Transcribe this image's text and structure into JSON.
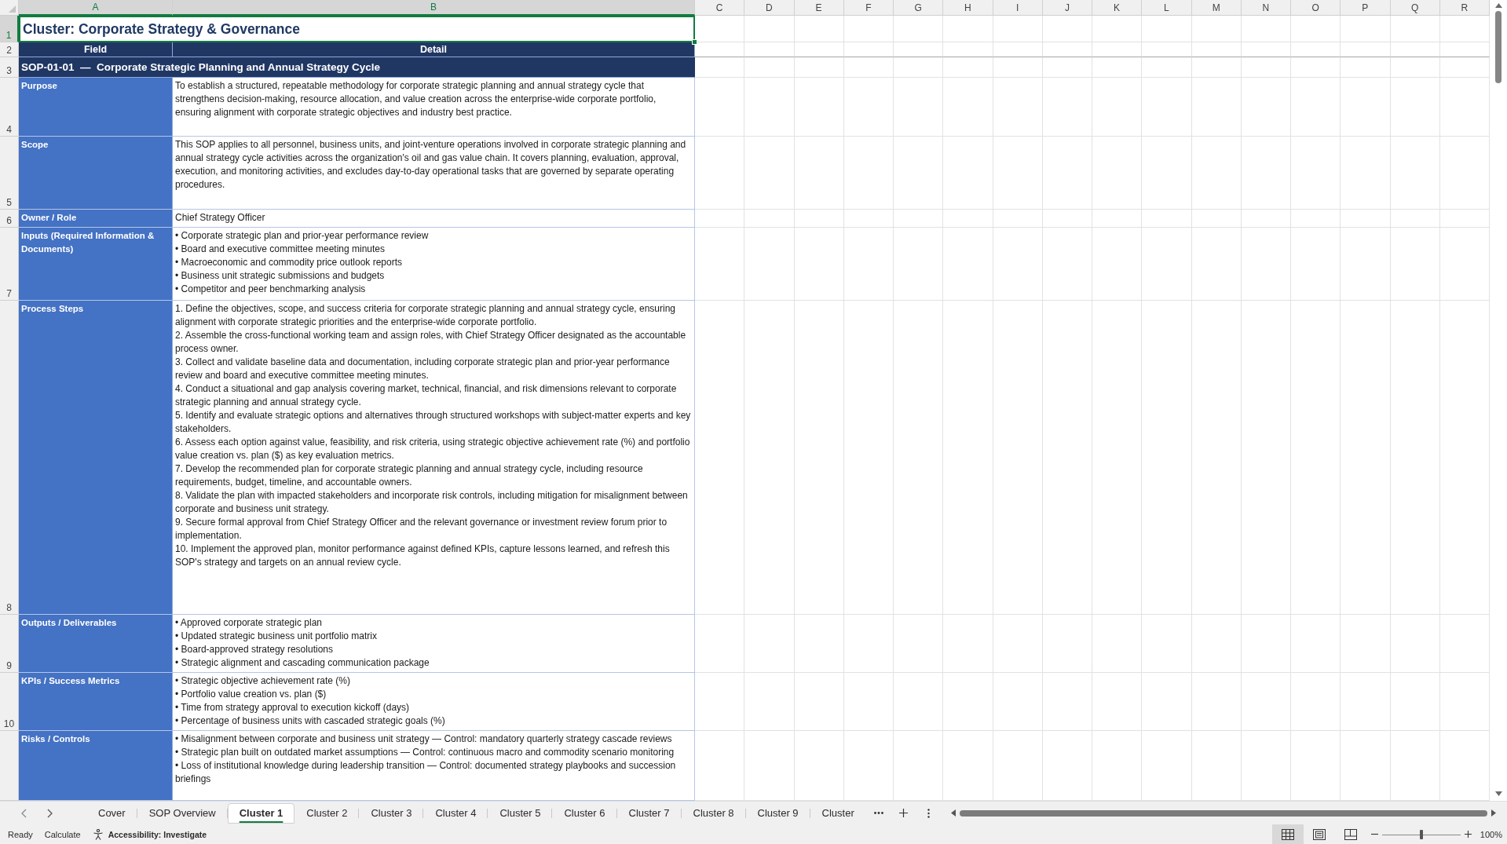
{
  "columns": [
    {
      "label": "A",
      "selected": true
    },
    {
      "label": "B",
      "selected": true
    },
    {
      "label": "C",
      "selected": false
    },
    {
      "label": "D",
      "selected": false
    },
    {
      "label": "E",
      "selected": false
    },
    {
      "label": "F",
      "selected": false
    },
    {
      "label": "G",
      "selected": false
    },
    {
      "label": "H",
      "selected": false
    },
    {
      "label": "I",
      "selected": false
    },
    {
      "label": "J",
      "selected": false
    },
    {
      "label": "K",
      "selected": false
    },
    {
      "label": "L",
      "selected": false
    },
    {
      "label": "M",
      "selected": false
    },
    {
      "label": "N",
      "selected": false
    },
    {
      "label": "O",
      "selected": false
    },
    {
      "label": "P",
      "selected": false
    },
    {
      "label": "Q",
      "selected": false
    },
    {
      "label": "R",
      "selected": false
    }
  ],
  "row_headers": [
    {
      "label": "1",
      "selected": true
    },
    {
      "label": "2",
      "selected": false
    },
    {
      "label": "3",
      "selected": false
    },
    {
      "label": "4",
      "selected": false
    },
    {
      "label": "5",
      "selected": false
    },
    {
      "label": "6",
      "selected": false
    },
    {
      "label": "7",
      "selected": false
    },
    {
      "label": "8",
      "selected": false
    },
    {
      "label": "9",
      "selected": false
    },
    {
      "label": "10",
      "selected": false
    }
  ],
  "title": {
    "text": "Cluster: Corporate Strategy & Governance",
    "selected": true
  },
  "table_header": [
    "Field",
    "Detail"
  ],
  "section_heading": "SOP-01-01  —  Corporate Strategic Planning and Annual Strategy Cycle",
  "fields": [
    {
      "label": "Purpose",
      "kind": "text",
      "text": "To establish a structured, repeatable methodology for corporate strategic planning and annual strategy cycle that strengthens decision-making, resource allocation, and value creation across the enterprise-wide corporate portfolio, ensuring alignment with corporate strategic objectives and industry best practice."
    },
    {
      "label": "Scope",
      "kind": "text",
      "text": "This SOP applies to all personnel, business units, and joint-venture operations involved in corporate strategic planning and annual strategy cycle activities across the organization's oil and gas value chain. It covers planning, evaluation, approval, execution, and monitoring activities, and excludes day-to-day operational tasks that are governed by separate operating procedures."
    },
    {
      "label": "Owner / Role",
      "kind": "text",
      "text": "Chief Strategy Officer"
    },
    {
      "label": "Inputs (Required Information & Documents)",
      "kind": "list",
      "items": [
        "• Corporate strategic plan and prior-year performance review",
        "• Board and executive committee meeting minutes",
        "• Macroeconomic and commodity price outlook reports",
        "• Business unit strategic submissions and budgets",
        "• Competitor and peer benchmarking analysis"
      ]
    },
    {
      "label": "Process Steps",
      "kind": "list",
      "items": [
        "1. Define the objectives, scope, and success criteria for corporate strategic planning and annual strategy cycle, ensuring alignment with corporate strategic priorities and the enterprise-wide corporate portfolio.",
        "2. Assemble the cross-functional working team and assign roles, with Chief Strategy Officer designated as the accountable process owner.",
        "3. Collect and validate baseline data and documentation, including corporate strategic plan and prior-year performance review and board and executive committee meeting minutes.",
        "4. Conduct a situational and gap analysis covering market, technical, financial, and risk dimensions relevant to corporate strategic planning and annual strategy cycle.",
        "5. Identify and evaluate strategic options and alternatives through structured workshops with subject-matter experts and key stakeholders.",
        "6. Assess each option against value, feasibility, and risk criteria, using strategic objective achievement rate (%) and portfolio value creation vs. plan ($) as key evaluation metrics.",
        "7. Develop the recommended plan for corporate strategic planning and annual strategy cycle, including resource requirements, budget, timeline, and accountable owners.",
        "8. Validate the plan with impacted stakeholders and incorporate risk controls, including mitigation for misalignment between corporate and business unit strategy.",
        "9. Secure formal approval from Chief Strategy Officer and the relevant governance or investment review forum prior to implementation.",
        "10. Implement the approved plan, monitor performance against defined KPIs, capture lessons learned, and refresh this SOP's strategy and targets on an annual review cycle."
      ]
    },
    {
      "label": "Outputs / Deliverables",
      "kind": "list",
      "items": [
        "• Approved corporate strategic plan",
        "• Updated strategic business unit portfolio matrix",
        "• Board-approved strategy resolutions",
        "• Strategic alignment and cascading communication package"
      ]
    },
    {
      "label": "KPIs / Success Metrics",
      "kind": "list",
      "items": [
        "• Strategic objective achievement rate (%)",
        "• Portfolio value creation vs. plan ($)",
        "• Time from strategy approval to execution kickoff (days)",
        "• Percentage of business units with cascaded strategic goals (%)"
      ]
    },
    {
      "label": "Risks / Controls",
      "kind": "list",
      "items": [
        "• Misalignment between corporate and business unit strategy — Control: mandatory quarterly strategy cascade reviews",
        "• Strategic plan built on outdated market assumptions — Control: continuous macro and commodity scenario monitoring",
        "• Loss of institutional knowledge during leadership transition — Control: documented strategy playbooks and succession briefings"
      ]
    }
  ],
  "sheet_tabs": [
    {
      "label": "Cover",
      "selected": false
    },
    {
      "label": "SOP Overview",
      "selected": false
    },
    {
      "label": "Cluster 1",
      "selected": true
    },
    {
      "label": "Cluster 2",
      "selected": false
    },
    {
      "label": "Cluster 3",
      "selected": false
    },
    {
      "label": "Cluster 4",
      "selected": false
    },
    {
      "label": "Cluster 5",
      "selected": false
    },
    {
      "label": "Cluster 6",
      "selected": false
    },
    {
      "label": "Cluster 7",
      "selected": false
    },
    {
      "label": "Cluster 8",
      "selected": false
    },
    {
      "label": "Cluster 9",
      "selected": false
    },
    {
      "label": "Cluster",
      "selected": false
    }
  ],
  "status_bar": {
    "mode": "Ready",
    "calculate": "Calculate",
    "accessibility": "Accessibility: Investigate",
    "views": [
      {
        "kind": "normal",
        "selected": true
      },
      {
        "kind": "page_layout",
        "selected": false
      },
      {
        "kind": "page_break",
        "selected": false
      }
    ],
    "zoom": {
      "level": 0.5,
      "reading": "100%"
    }
  }
}
